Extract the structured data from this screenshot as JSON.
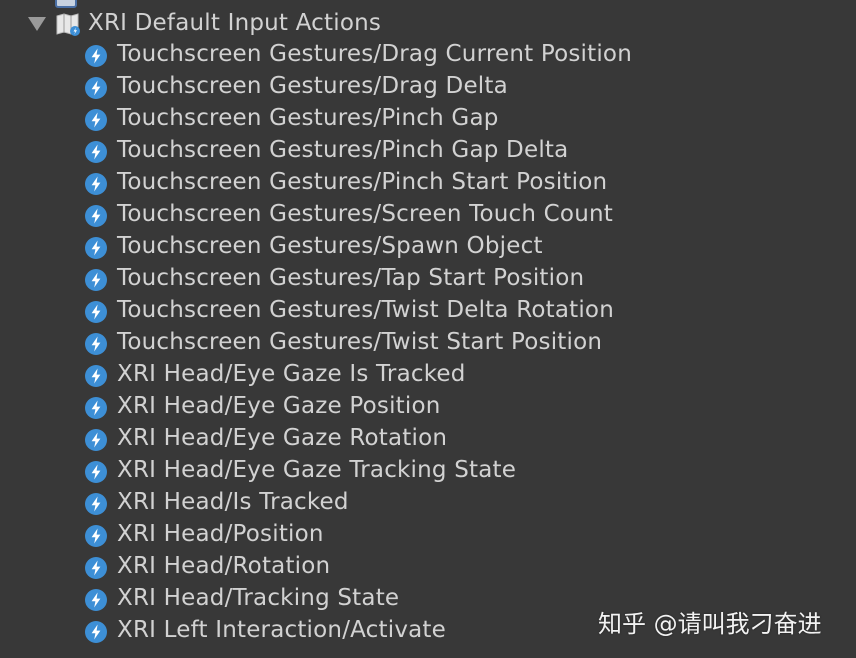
{
  "hierarchy": {
    "parent": {
      "label": "XRI Default Input Actions",
      "icon": "input-action-map-icon",
      "expanded": true
    },
    "action_icon": "lightning-bolt-icon",
    "actions": [
      "Touchscreen Gestures/Drag Current Position",
      "Touchscreen Gestures/Drag Delta",
      "Touchscreen Gestures/Pinch Gap",
      "Touchscreen Gestures/Pinch Gap Delta",
      "Touchscreen Gestures/Pinch Start Position",
      "Touchscreen Gestures/Screen Touch Count",
      "Touchscreen Gestures/Spawn Object",
      "Touchscreen Gestures/Tap Start Position",
      "Touchscreen Gestures/Twist Delta Rotation",
      "Touchscreen Gestures/Twist Start Position",
      "XRI Head/Eye Gaze Is Tracked",
      "XRI Head/Eye Gaze Position",
      "XRI Head/Eye Gaze Rotation",
      "XRI Head/Eye Gaze Tracking State",
      "XRI Head/Is Tracked",
      "XRI Head/Position",
      "XRI Head/Rotation",
      "XRI Head/Tracking State",
      "XRI Left Interaction/Activate"
    ]
  },
  "watermark": "知乎 @请叫我刁奋进",
  "colors": {
    "background": "#383838",
    "text": "#d2d2d2",
    "icon_circle": "#3d8fd6",
    "icon_bolt": "#ffffff"
  }
}
